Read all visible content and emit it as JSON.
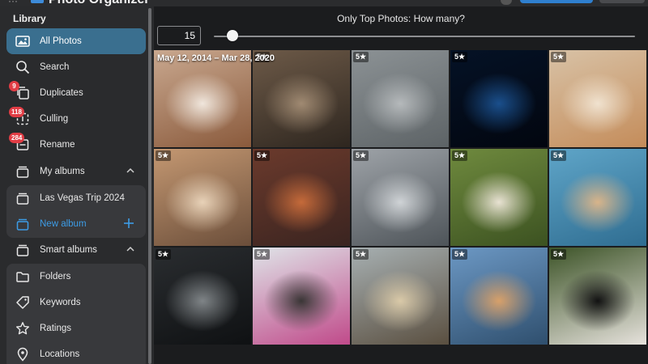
{
  "app": {
    "title": "Photo Organizer"
  },
  "sidebar": {
    "heading": "Library",
    "items": [
      {
        "label": "All Photos",
        "icon": "photos-icon",
        "active": true
      },
      {
        "label": "Search",
        "icon": "search-icon"
      },
      {
        "label": "Duplicates",
        "icon": "duplicates-icon",
        "badge": "9"
      },
      {
        "label": "Culling",
        "icon": "culling-icon",
        "badge": "118"
      },
      {
        "label": "Rename",
        "icon": "rename-icon",
        "badge": "284"
      }
    ],
    "my_albums": {
      "label": "My albums",
      "icon": "albums-icon"
    },
    "albums": [
      {
        "label": "Las Vegas Trip 2024",
        "icon": "album-icon"
      }
    ],
    "new_album": {
      "label": "New album",
      "icon": "album-icon"
    },
    "smart_albums": {
      "label": "Smart albums",
      "icon": "albums-icon"
    },
    "smart_items": [
      {
        "label": "Folders",
        "icon": "folder-icon"
      },
      {
        "label": "Keywords",
        "icon": "tag-icon"
      },
      {
        "label": "Ratings",
        "icon": "star-icon"
      },
      {
        "label": "Locations",
        "icon": "location-pin-icon"
      }
    ]
  },
  "controls": {
    "label": "Only Top Photos: How many?",
    "count_value": "15",
    "slider_fraction": 0.045
  },
  "grid": {
    "date_range": "May 12, 2014 – Mar 28, 2020",
    "tiles": [
      {
        "subject": "calico cat",
        "rating": "",
        "colors": [
          "#c9a88f",
          "#f0e6dc",
          "#8a5a3c"
        ]
      },
      {
        "subject": "tabby cat",
        "rating": "5★",
        "colors": [
          "#6d5a48",
          "#a08a72",
          "#2e261f"
        ]
      },
      {
        "subject": "grey cat",
        "rating": "5★",
        "colors": [
          "#8c9295",
          "#b5b9bb",
          "#5d6366"
        ]
      },
      {
        "subject": "jellyfish",
        "rating": "5★",
        "colors": [
          "#051226",
          "#1a4f8c",
          "#02060f"
        ]
      },
      {
        "subject": "kitten in cat house",
        "rating": "5★",
        "colors": [
          "#d8c2a6",
          "#f0e2cf",
          "#c48c5a"
        ]
      },
      {
        "subject": "orange cat",
        "rating": "5★",
        "colors": [
          "#c49872",
          "#e8d2b8",
          "#6b4e3a"
        ]
      },
      {
        "subject": "fox",
        "rating": "5★",
        "colors": [
          "#6b3a2c",
          "#c56a3a",
          "#3a2420"
        ]
      },
      {
        "subject": "person walking dog",
        "rating": "5★",
        "colors": [
          "#9ea3a8",
          "#cfd3d6",
          "#4e5459"
        ]
      },
      {
        "subject": "golden retriever",
        "rating": "5★",
        "colors": [
          "#6f8a3e",
          "#e8e2d2",
          "#3c5221"
        ]
      },
      {
        "subject": "two dogs",
        "rating": "5★",
        "colors": [
          "#5fa5c8",
          "#d8b48a",
          "#2f6d91"
        ]
      },
      {
        "subject": "husky eye",
        "rating": "5★",
        "colors": [
          "#2a2d30",
          "#7f8487",
          "#0f1113"
        ]
      },
      {
        "subject": "dog with goggles",
        "rating": "5★",
        "colors": [
          "#dfe4e8",
          "#3a3636",
          "#c04a8a"
        ]
      },
      {
        "subject": "girl with balloons",
        "rating": "5★",
        "colors": [
          "#a7b0b2",
          "#d9c9a8",
          "#5a4f40"
        ]
      },
      {
        "subject": "coastal rock",
        "rating": "5★",
        "colors": [
          "#6c98c4",
          "#d7a06a",
          "#2f4f6e"
        ]
      },
      {
        "subject": "black puppy",
        "rating": "5★",
        "colors": [
          "#3d5428",
          "#121212",
          "#e6e2dc"
        ]
      }
    ]
  },
  "colors": {
    "accent": "#3d9ce6",
    "active_bg": "#3a6f8f",
    "badge": "#e23d45",
    "sidebar_bg": "#2a2b2d"
  }
}
